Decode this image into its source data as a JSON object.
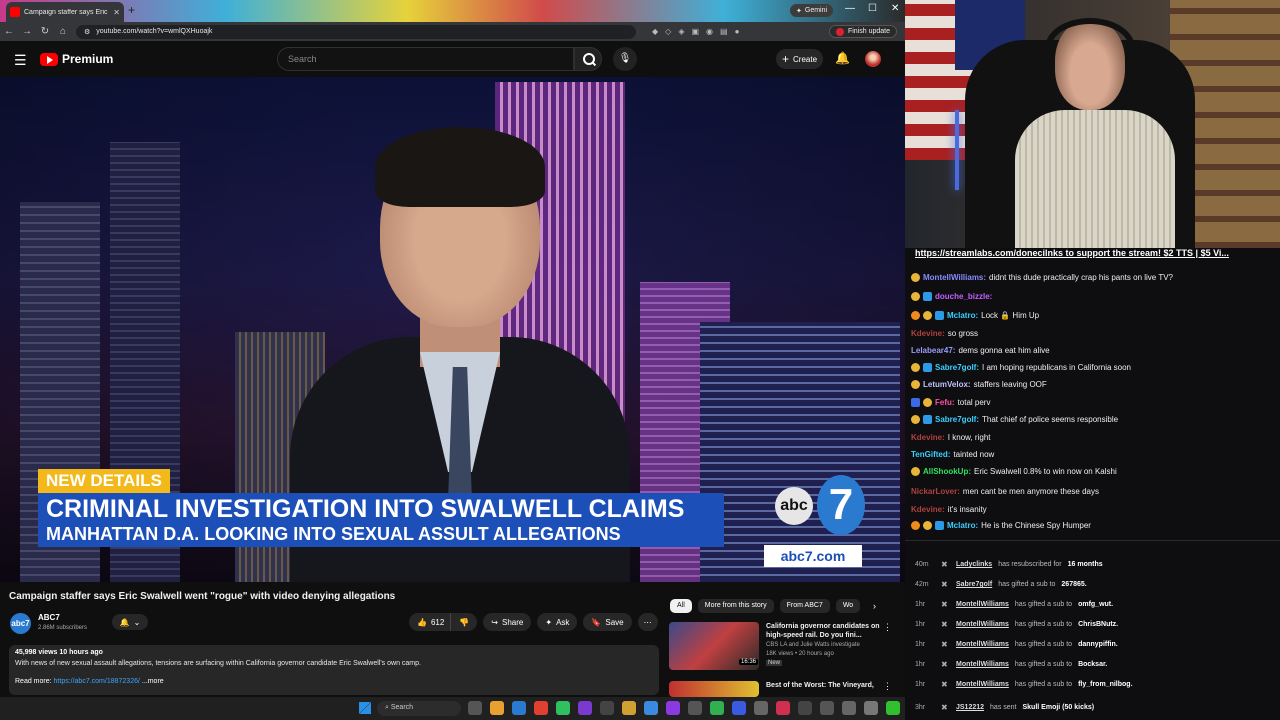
{
  "browser": {
    "tab_title": "Campaign staffer says Eric",
    "url": "youtube.com/watch?v=wmlQXHuoajk",
    "gemini_label": "Gemini",
    "finish_update_label": "Finish update"
  },
  "youtube": {
    "logo_text": "Premium",
    "search_placeholder": "Search",
    "create_label": "Create"
  },
  "video": {
    "tag": "NEW DETAILS",
    "headline_1": "CRIMINAL INVESTIGATION INTO SWALWELL CLAIMS",
    "headline_2": "MANHATTAN D.A. LOOKING INTO SEXUAL ASSULT ALLEGATIONS",
    "abc_logo_text": "abc",
    "abc_logo_number": "7",
    "abc_url": "abc7.com"
  },
  "watch": {
    "title": "Campaign staffer says Eric Swalwell went \"rogue\" with video denying allegations",
    "channel_name": "ABC7",
    "channel_subs": "2.86M subscribers",
    "likes": "612",
    "share_label": "Share",
    "ask_label": "Ask",
    "save_label": "Save",
    "desc_meta": "45,998 views  10 hours ago",
    "desc_line": "With news of new sexual assault allegations, tensions are surfacing within California governor candidate Eric Swalwell's own camp.",
    "desc_read_more": "Read more:",
    "desc_link": "https://abc7.com/18872326/",
    "desc_more": "...more"
  },
  "related": {
    "chips": [
      "All",
      "More from this story",
      "From ABC7",
      "Wo"
    ],
    "items": [
      {
        "title": "California governor candidates on high-speed rail. Do you fini...",
        "channel": "CBS LA and Julie Watts investigate",
        "meta": "18K views • 20 hours ago",
        "badge": "New",
        "duration": "16:36"
      },
      {
        "title": "Best of the Worst: The Vineyard,"
      }
    ]
  },
  "taskbar": {
    "search_label": "Search"
  },
  "chat": {
    "banner": "https://streamlabs.com/donecilnks to support the stream! $2 TTS | $5 Vi...",
    "messages": [
      {
        "user": "MontellWilliams:",
        "text": "didnt this dude practically crap his pants on live TV?",
        "color": "#8a8aff"
      },
      {
        "user": "douche_bizzle:",
        "text": "",
        "color": "#c060ff"
      },
      {
        "user": "Mclatro:",
        "text": "Lock 🔒 Him Up",
        "color": "#3ad0ff"
      },
      {
        "user": "Kdevine:",
        "text": "so gross",
        "color": "#b04040"
      },
      {
        "user": "Lelabear47:",
        "text": "dems gonna eat him alive",
        "color": "#9a9aff"
      },
      {
        "user": "Sabre7golf:",
        "text": "I am hoping republicans in California soon",
        "color": "#3ad0ff"
      },
      {
        "user": "LetumVelox:",
        "text": "staffers leaving OOF",
        "color": "#c0c0ff"
      },
      {
        "user": "Fefu:",
        "text": "total perv",
        "color": "#ff50a0"
      },
      {
        "user": "Sabre7golf:",
        "text": "That chief of police seems responsible",
        "color": "#3ad0ff"
      },
      {
        "user": "Kdevine:",
        "text": "I know, right",
        "color": "#b04040"
      },
      {
        "user": "TenGifted:",
        "text": "tainted now",
        "color": "#3ad0ff"
      },
      {
        "user": "AllShookUp:",
        "text": "Eric Swalwell 0.8% to win now on Kalshi",
        "color": "#30e060"
      },
      {
        "user": "NickarLover:",
        "text": "men cant be men anymore these days",
        "color": "#b04040"
      },
      {
        "user": "Kdevine:",
        "text": "it's insanity",
        "color": "#b04040"
      },
      {
        "user": "Mclatro:",
        "text": "He is the Chinese Spy Humper",
        "color": "#3ad0ff"
      }
    ]
  },
  "events": [
    {
      "time": "40m",
      "user": "Ladyclinks",
      "action": "has resubscribed for",
      "highlight": "16 months"
    },
    {
      "time": "42m",
      "user": "Sabre7golf",
      "action": "has gifted a sub to",
      "highlight": "267865."
    },
    {
      "time": "1hr",
      "user": "MontellWilliams",
      "action": "has gifted a sub to",
      "highlight": "omfg_wut."
    },
    {
      "time": "1hr",
      "user": "MontellWilliams",
      "action": "has gifted a sub to",
      "highlight": "ChrisBNutz."
    },
    {
      "time": "1hr",
      "user": "MontellWilliams",
      "action": "has gifted a sub to",
      "highlight": "dannypiffin."
    },
    {
      "time": "1hr",
      "user": "MontellWilliams",
      "action": "has gifted a sub to",
      "highlight": "Bocksar."
    },
    {
      "time": "1hr",
      "user": "MontellWilliams",
      "action": "has gifted a sub to",
      "highlight": "fly_from_nilbog."
    },
    {
      "time": "3hr",
      "user": "JS12212",
      "action": "has sent",
      "highlight": "Skull Emoji (50 kicks)"
    }
  ]
}
